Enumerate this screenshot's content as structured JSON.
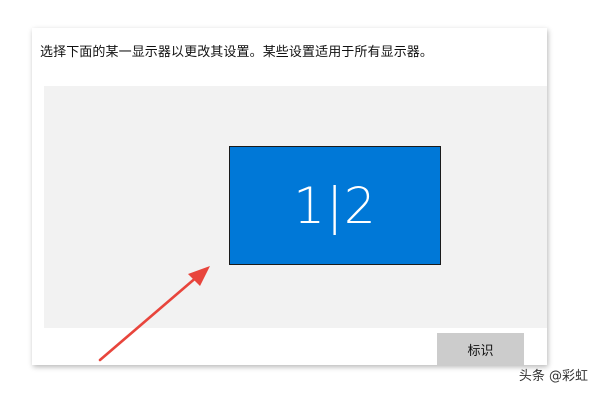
{
  "panel": {
    "instruction_text": "选择下面的某一显示器以更改其设置。某些设置适用于所有显示器。"
  },
  "display_arrangement": {
    "monitor_label": "1|2",
    "monitor_color": "#0078d7",
    "area_color": "#f2f2f2"
  },
  "actions": {
    "identify_label": "标识"
  },
  "annotation": {
    "arrow_color": "#e8453c",
    "arrow_icon": "red-arrow-icon"
  },
  "watermark": {
    "text": "头条 @彩虹"
  }
}
